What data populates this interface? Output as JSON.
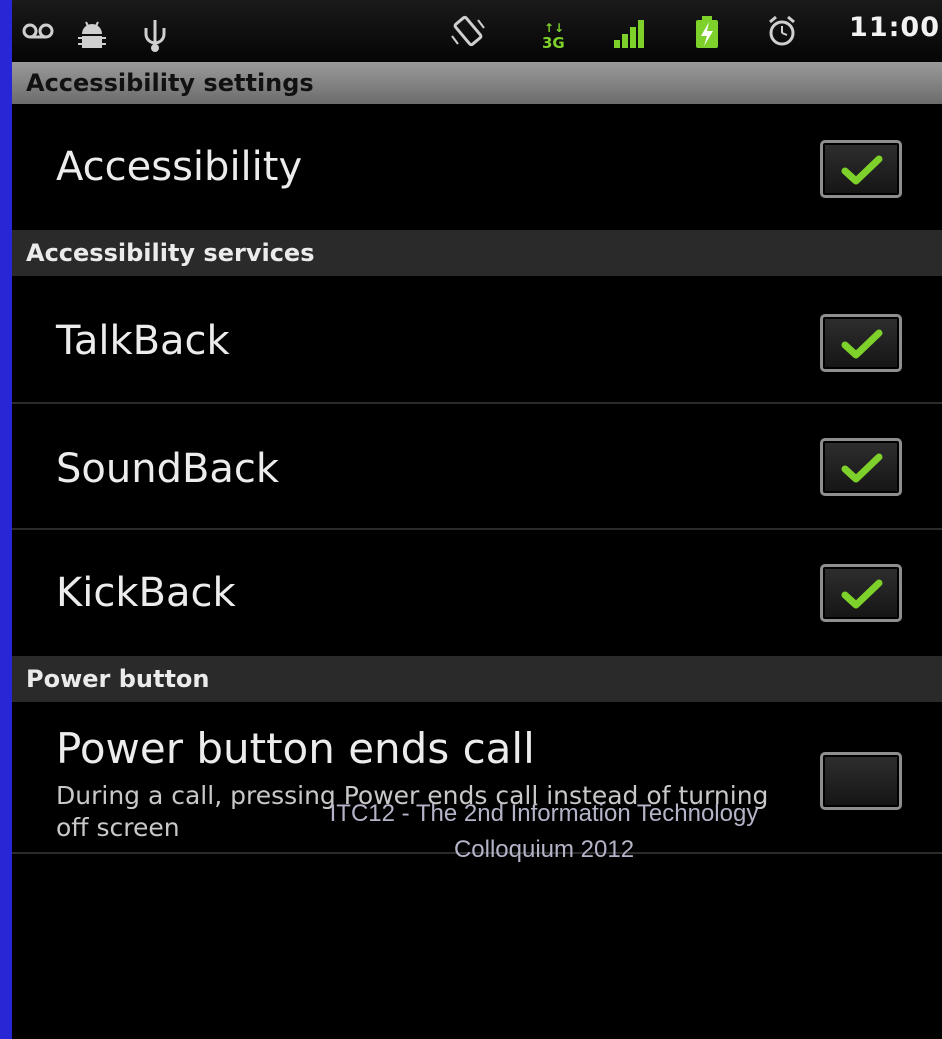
{
  "status_bar": {
    "time": "11:00",
    "icons": [
      "voicemail-icon",
      "android-debug-icon",
      "usb-icon",
      "vibrate-icon",
      "3g-icon",
      "signal-icon",
      "battery-charging-icon",
      "alarm-icon"
    ]
  },
  "screen": {
    "title": "Accessibility settings",
    "items": [
      {
        "label": "Accessibility",
        "checked": true
      }
    ],
    "sections": [
      {
        "header": "Accessibility services",
        "items": [
          {
            "label": "TalkBack",
            "checked": true
          },
          {
            "label": "SoundBack",
            "checked": true
          },
          {
            "label": "KickBack",
            "checked": true
          }
        ]
      },
      {
        "header": "Power button",
        "items": [
          {
            "label": "Power button ends call",
            "summary": "During a call, pressing Power ends call instead of turning off screen",
            "checked": false
          }
        ]
      }
    ]
  },
  "footer": {
    "line1": "ITC12 - The 2nd Information Technology",
    "line2": "Colloquium 2012"
  },
  "colors": {
    "slide_background": "#2727d6",
    "check_green": "#7ed12a"
  }
}
